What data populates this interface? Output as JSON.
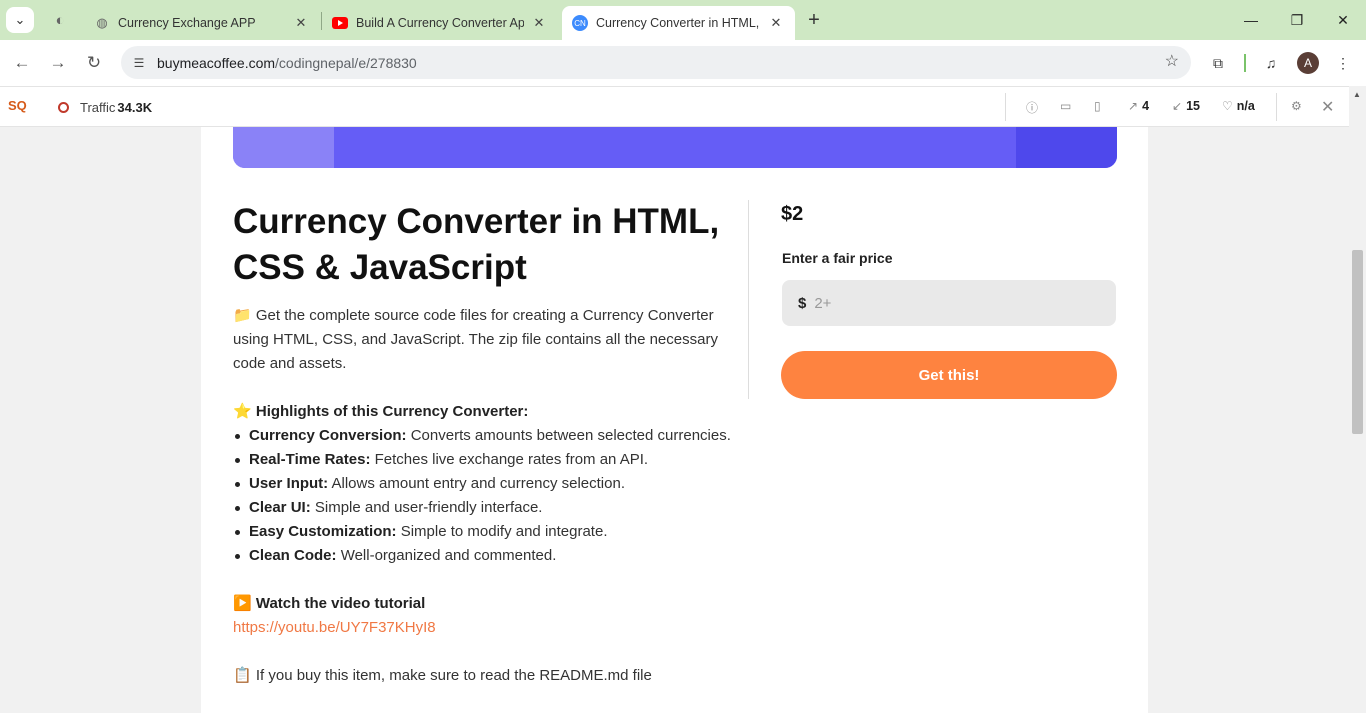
{
  "browser": {
    "tabs": [
      {
        "title": "Currency Exchange APP",
        "favicon": "globe-icon",
        "active": false
      },
      {
        "title": "Build A Currency Converter App",
        "favicon": "youtube-icon",
        "active": false
      },
      {
        "title": "Currency Converter in HTML, CSS",
        "favicon": "codingnepal-icon",
        "active": true
      }
    ],
    "url_host": "buymeacoffee.com",
    "url_path": "/codingnepal/e/278830",
    "profile_initial": "A"
  },
  "extension_bar": {
    "logo": "SQ",
    "traffic_label": "Traffic",
    "traffic_value": "34.3K",
    "ext_links": "4",
    "int_links": "15",
    "rating": "n/a"
  },
  "product": {
    "title": "Currency Converter in HTML, CSS & JavaScript",
    "intro_emoji": "📁",
    "intro": "Get the complete source code files for creating a Currency Converter using HTML, CSS, and JavaScript. The zip file contains all the necessary code and assets.",
    "highlights_emoji": "⭐",
    "highlights_heading": "Highlights of this Currency Converter:",
    "features": [
      {
        "name": "Currency Conversion:",
        "text": "Converts amounts between selected currencies."
      },
      {
        "name": "Real-Time Rates:",
        "text": "Fetches live exchange rates from an API."
      },
      {
        "name": "User Input:",
        "text": "Allows amount entry and currency selection."
      },
      {
        "name": "Clear UI:",
        "text": "Simple and user-friendly interface."
      },
      {
        "name": "Easy Customization:",
        "text": "Simple to modify and integrate."
      },
      {
        "name": "Clean Code:",
        "text": "Well-organized and commented."
      }
    ],
    "video_emoji": "▶️",
    "video_heading": "Watch the video tutorial",
    "video_link": "https://youtu.be/UY7F37KHyI8",
    "readme_emoji": "📋",
    "readme_text": "If you buy this item, make sure to read the README.md file"
  },
  "purchase": {
    "price": "$2",
    "fair_price_label": "Enter a fair price",
    "currency_symbol": "$",
    "price_placeholder": "2+",
    "button_label": "Get this!"
  },
  "colors": {
    "accent": "#fe8340",
    "banner": "#655df6",
    "tabstrip": "#cfe8c4"
  }
}
